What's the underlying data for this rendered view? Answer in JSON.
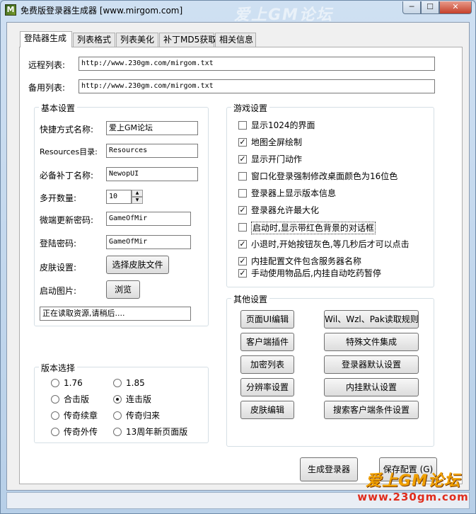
{
  "window": {
    "title": "免费版登录器生成器 [www.mirgom.com]",
    "icon_label": "M",
    "title_decoration": "爱上GM论坛",
    "min_label": "─",
    "max_label": "☐",
    "close_label": "✕"
  },
  "tabs": [
    "登陆器生成",
    "列表格式",
    "列表美化",
    "补丁MD5获取",
    "相关信息"
  ],
  "lists": {
    "remote_label": "远程列表:",
    "remote_value": "http://www.230gm.com/mirgom.txt",
    "backup_label": "备用列表:",
    "backup_value": "http://www.230gm.com/mirgom.txt"
  },
  "basic": {
    "title": "基本设置",
    "shortcut_label": "快捷方式名称:",
    "shortcut_value": "爱上GM论坛",
    "resources_label": "Resources目录:",
    "resources_value": "Resources",
    "patch_label": "必备补丁名称:",
    "patch_value": "NewopUI",
    "multi_label": "多开数量:",
    "multi_value": "10",
    "update_pwd_label": "微端更新密码:",
    "update_pwd_value": "GameOfMir",
    "login_pwd_label": "登陆密码:",
    "login_pwd_value": "GameOfMir",
    "skin_label": "皮肤设置:",
    "skin_button": "选择皮肤文件",
    "splash_label": "启动图片:",
    "browse_button": "浏览",
    "status_text": "正在读取资源,请稍后...."
  },
  "version": {
    "title": "版本选择",
    "options": [
      "1.76",
      "1.85",
      "合击版",
      "连击版",
      "传奇续章",
      "传奇归来",
      "传奇外传",
      "13周年新页面版"
    ],
    "selected": "连击版"
  },
  "game": {
    "title": "游戏设置",
    "options": [
      {
        "label": "显示1024的界面",
        "checked": false
      },
      {
        "label": "地图全屏绘制",
        "checked": true
      },
      {
        "label": "显示开门动作",
        "checked": true
      },
      {
        "label": "窗口化登录强制修改桌面颜色为16位色",
        "checked": false
      },
      {
        "label": "登录器上显示版本信息",
        "checked": false
      },
      {
        "label": "登录器允许最大化",
        "checked": true
      },
      {
        "label": "启动时,显示带红色背景的对话框",
        "checked": false
      },
      {
        "label": "小退时,开始按钮灰色,等几秒后才可以点击",
        "checked": true
      },
      {
        "label": "内挂配置文件包含服务器名称",
        "checked": true
      },
      {
        "label": "手动使用物品后,内挂自动吃药暂停",
        "checked": true
      }
    ]
  },
  "other": {
    "title": "其他设置",
    "buttons": [
      "页面UI编辑",
      "Wil、Wzl、Pak读取规则",
      "客户端插件",
      "特殊文件集成",
      "加密列表",
      "登录器默认设置",
      "分辨率设置",
      "内挂默认设置",
      "皮肤编辑",
      "搜索客户端条件设置"
    ]
  },
  "actions": {
    "generate": "生成登录器",
    "save": "保存配置 (G)"
  },
  "watermark": {
    "line1": "爱上GM论坛",
    "line2": "www.230gm.com"
  }
}
